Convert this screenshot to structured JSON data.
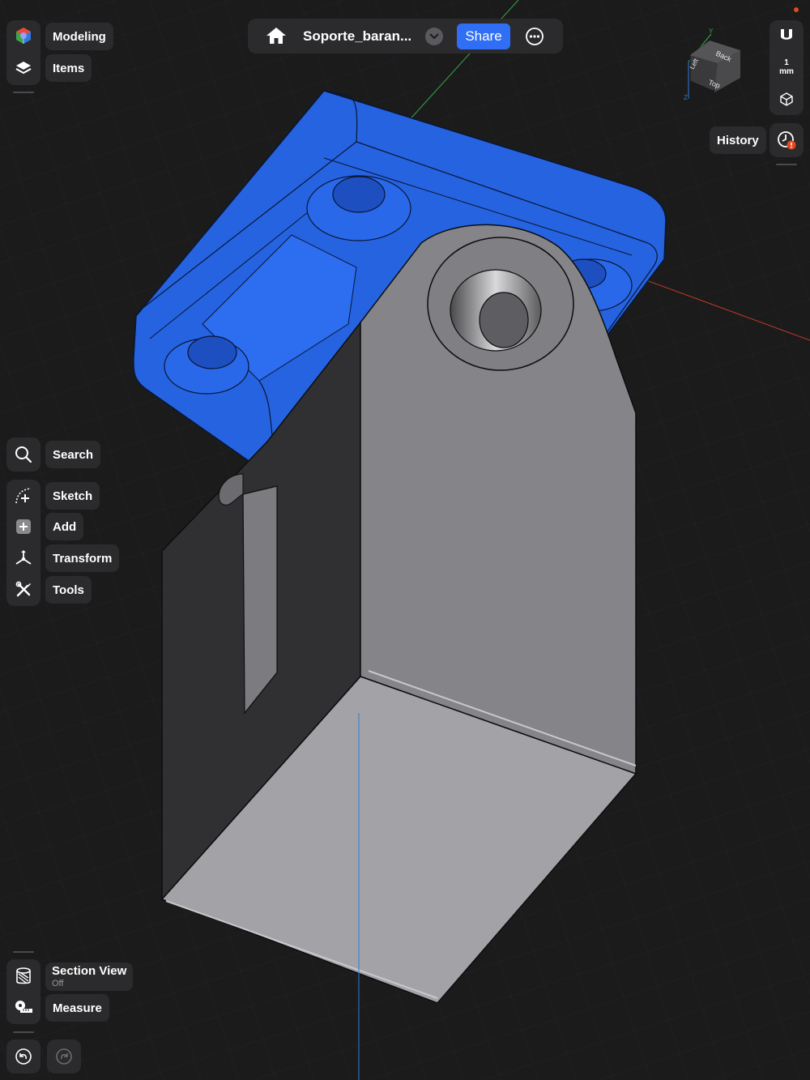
{
  "document": {
    "title": "Soporte_baran...",
    "share_label": "Share"
  },
  "left_toolbar": {
    "top": [
      {
        "label": "Modeling",
        "icon": "modeling-cube-icon"
      },
      {
        "label": "Items",
        "icon": "layers-icon"
      }
    ],
    "tools": [
      {
        "label": "Search",
        "icon": "search-icon"
      },
      {
        "label": "Sketch",
        "icon": "sketch-icon"
      },
      {
        "label": "Add",
        "icon": "plus-icon"
      },
      {
        "label": "Transform",
        "icon": "transform-icon"
      },
      {
        "label": "Tools",
        "icon": "wrench-screwdriver-icon"
      }
    ],
    "bottom": [
      {
        "label": "Section View",
        "sublabel": "Off",
        "icon": "section-view-icon"
      },
      {
        "label": "Measure",
        "icon": "tape-measure-icon"
      }
    ]
  },
  "right_toolbar": {
    "snap_unit_value": "1",
    "snap_unit": "mm",
    "history_label": "History"
  },
  "view_cube": {
    "faces": [
      "Back",
      "Left",
      "Top"
    ],
    "axes": [
      "Y",
      "Z"
    ]
  },
  "colors": {
    "background": "#1b1b1c",
    "panel": "#2b2b2d",
    "accent": "#2f6ef5",
    "selection_blue": "#2a6ae8",
    "part_gray": "#8a8a8e",
    "axis_x": "#c0392b",
    "axis_y": "#3aa54a",
    "axis_z": "#2e7bd8",
    "warning": "#e0491f"
  }
}
